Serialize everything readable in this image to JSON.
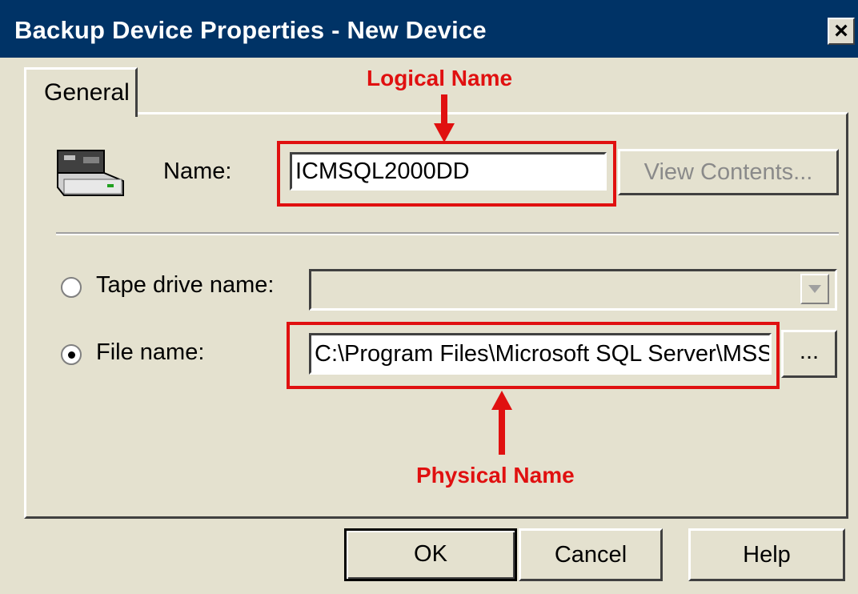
{
  "window": {
    "title": "Backup Device Properties - New Device",
    "close_label": "×"
  },
  "tabs": [
    {
      "label": "General"
    }
  ],
  "annotations": {
    "logical": "Logical Name",
    "physical": "Physical Name"
  },
  "form": {
    "name_label": "Name:",
    "name_value": "ICMSQL2000DD",
    "view_contents_label": "View Contents...",
    "tape_label": "Tape drive name:",
    "tape_value": "",
    "file_label": "File name:",
    "file_value": "C:\\Program Files\\Microsoft SQL Server\\MSS",
    "browse_label": "...",
    "selected_option": "file"
  },
  "buttons": {
    "ok": "OK",
    "cancel": "Cancel",
    "help": "Help"
  },
  "colors": {
    "titlebar": "#003366",
    "annotation": "#e01010",
    "dialog": "#e4e1cf"
  }
}
